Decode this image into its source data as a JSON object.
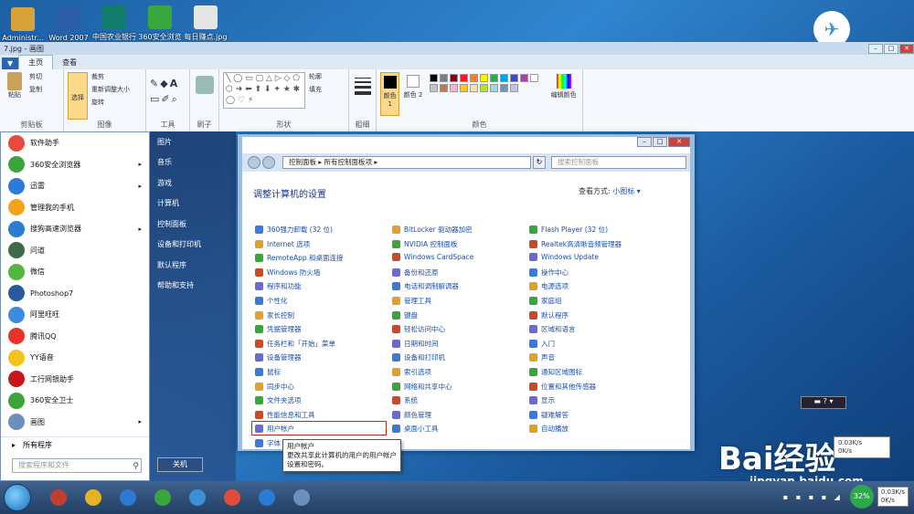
{
  "desktop_icons": [
    {
      "label": "Administr...",
      "color": "#d8a23a"
    },
    {
      "label": "Word 2007",
      "color": "#2b5da8"
    },
    {
      "label": "中国农业银行",
      "color": "#0f7d6a"
    },
    {
      "label": "360安全浏览",
      "color": "#38a83c"
    },
    {
      "label": "每日赚点.jpg",
      "color": "#e6e6e6"
    }
  ],
  "paint": {
    "title": "7.jpg - 画图",
    "menu_label": "▼",
    "tabs": [
      "主页",
      "查看"
    ],
    "groups": {
      "clipboard": {
        "label": "剪贴板",
        "paste": "粘贴",
        "cut": "剪切",
        "copy": "复制"
      },
      "image": {
        "label": "图像",
        "select": "选择",
        "crop": "裁剪",
        "resize": "重新调整大小",
        "rotate": "旋转"
      },
      "tools": {
        "label": "工具",
        "letter": "A"
      },
      "brushes": {
        "label": "刷子"
      },
      "shapes": {
        "label": "形状",
        "outline": "轮廓",
        "fill": "填充"
      },
      "size": {
        "label": "粗细"
      },
      "colors": {
        "label": "颜色",
        "color1": "颜色 1",
        "color2": "颜色 2",
        "edit": "编辑颜色"
      }
    },
    "palette": [
      "#000000",
      "#7f7f7f",
      "#880015",
      "#ed1c24",
      "#ff7f27",
      "#fff200",
      "#22b14c",
      "#00a2e8",
      "#3f48cc",
      "#a349a4",
      "#ffffff",
      "#c3c3c3",
      "#b97a57",
      "#ffaec9",
      "#ffc90e",
      "#efe4b0",
      "#b5e61d",
      "#99d9ea",
      "#7092be",
      "#c8bfe7"
    ]
  },
  "start_menu": {
    "left_items": [
      {
        "label": "软件助手",
        "color": "#e84b3c",
        "arrow": false
      },
      {
        "label": "360安全浏览器",
        "color": "#3aa53a",
        "arrow": true
      },
      {
        "label": "迅雷",
        "color": "#2d7ad8",
        "arrow": true
      },
      {
        "label": "管理我的手机",
        "color": "#f3a21a",
        "arrow": false
      },
      {
        "label": "搜狗高速浏览器",
        "color": "#2b7cd3",
        "arrow": true
      },
      {
        "label": "问道",
        "color": "#3e6a4a",
        "arrow": false
      },
      {
        "label": "微信",
        "color": "#53b63e",
        "arrow": false
      },
      {
        "label": "Photoshop7",
        "color": "#2b5a9c",
        "arrow": false
      },
      {
        "label": "阿里旺旺",
        "color": "#3b8be0",
        "arrow": false
      },
      {
        "label": "腾讯QQ",
        "color": "#e8332c",
        "arrow": false
      },
      {
        "label": "YY语音",
        "color": "#f4c21a",
        "arrow": false
      },
      {
        "label": "工行网银助手",
        "color": "#c6161d",
        "arrow": false
      },
      {
        "label": "360安全卫士",
        "color": "#3aa53a",
        "arrow": false
      },
      {
        "label": "画图",
        "color": "#6c8fbf",
        "arrow": true
      }
    ],
    "all_programs": "所有程序",
    "search_placeholder": "搜索程序和文件",
    "right_items": [
      "图片",
      "音乐",
      "游戏",
      "计算机",
      "控制面板",
      "设备和打印机",
      "默认程序",
      "帮助和支持"
    ],
    "shutdown": "关机"
  },
  "control_panel": {
    "breadcrumb": "控制面板 ▸ 所有控制面板项 ▸",
    "search_placeholder": "搜索控制面板",
    "heading": "调整计算机的设置",
    "view_label": "查看方式:",
    "view_value": "小图标 ▾",
    "col1": [
      "360强力卸载 (32 位)",
      "Internet 选项",
      "RemoteApp 和桌面连接",
      "Windows 防火墙",
      "程序和功能",
      "个性化",
      "家长控制",
      "凭据管理器",
      "任务栏和「开始」菜单",
      "设备管理器",
      "鼠标",
      "同步中心",
      "文件夹选项",
      "性能信息和工具",
      "用户帐户",
      "字体"
    ],
    "col2": [
      "BitLocker 驱动器加密",
      "NVIDIA 控制面板",
      "Windows CardSpace",
      "备份和还原",
      "电话和调制解调器",
      "管理工具",
      "键盘",
      "轻松访问中心",
      "日期和时间",
      "设备和打印机",
      "索引选项",
      "网络和共享中心",
      "系统",
      "颜色管理",
      "桌面小工具"
    ],
    "col3": [
      "Flash Player (32 位)",
      "Realtek高清晰音频管理器",
      "Windows Update",
      "操作中心",
      "电源选项",
      "家庭组",
      "默认程序",
      "区域和语言",
      "入门",
      "声音",
      "通知区域图标",
      "位置和其他传感器",
      "显示",
      "疑难解答",
      "自动播放"
    ],
    "icon_colors": [
      "#3b7bd6",
      "#e0a02a",
      "#3aa53a",
      "#c84a2a",
      "#6a6ad0"
    ]
  },
  "tooltip": {
    "title": "用户帐户",
    "desc": "更改共享此计算机的用户的用户帐户设置和密码。"
  },
  "taskbar": {
    "items": [
      {
        "color": "#c04030"
      },
      {
        "color": "#e6b422"
      },
      {
        "color": "#2e7ad1"
      },
      {
        "color": "#3aa53a"
      },
      {
        "color": "#3a8fd6"
      },
      {
        "color": "#e04b3a"
      },
      {
        "color": "#2b7cd3"
      },
      {
        "color": "#6c8fbf"
      }
    ],
    "battery": "32%",
    "net_up": "0.03K/s",
    "net_down": "0K/s"
  },
  "watermark": {
    "brand": "Bai经验",
    "url": "jingyan.baidu.com"
  }
}
